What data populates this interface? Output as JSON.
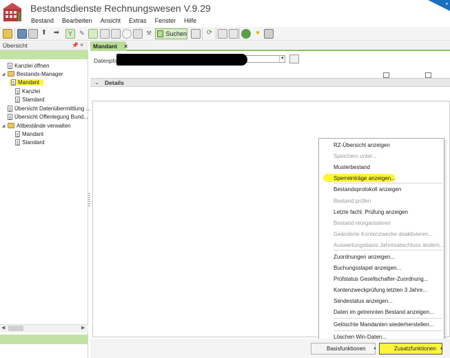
{
  "app": {
    "title": "Bestandsdienste Rechnungswesen V.9.29",
    "accent_green": "#8cc063",
    "highlight_yellow": "#fdf53a",
    "logo_icon": "house-grid-icon"
  },
  "menu": [
    "Bestand",
    "Bearbeiten",
    "Ansicht",
    "Extras",
    "Fenster",
    "Hilfe"
  ],
  "toolbar": {
    "search_label": "Suchen",
    "icons": [
      "open-folder-icon",
      "save-icon",
      "print-icon",
      "arrow-up-icon",
      "arrow-right-icon",
      "tree-icon",
      "wrench-icon",
      "grid-icon",
      "list-icon",
      "table-icon",
      "copy-icon",
      "clock-icon",
      "box-icon",
      "tools-icon",
      "export-icon",
      "refresh-icon",
      "panel-icon",
      "panel2-icon",
      "globe-icon",
      "lightbulb-icon",
      "tag-icon"
    ]
  },
  "sidebar": {
    "title": "Übersicht",
    "items": [
      {
        "label": "Kanzlei öffnen",
        "icon": "document-icon",
        "level": 0,
        "expander": ""
      },
      {
        "label": "Bestands-Manager",
        "icon": "folder-icon",
        "level": 0,
        "expander": "◢"
      },
      {
        "label": "Mandant",
        "icon": "document-icon",
        "level": 1,
        "expander": "",
        "selected": true
      },
      {
        "label": "Kanzlei",
        "icon": "document-icon",
        "level": 1,
        "expander": ""
      },
      {
        "label": "Standard",
        "icon": "document-icon",
        "level": 1,
        "expander": ""
      },
      {
        "label": "Übersicht Datenübermittlung ...",
        "icon": "document-icon",
        "level": 0,
        "expander": ""
      },
      {
        "label": "Übersicht Offenlegung Bund...",
        "icon": "document-icon",
        "level": 0,
        "expander": ""
      },
      {
        "label": "Altbestände verwalten",
        "icon": "folder-icon",
        "level": 0,
        "expander": "◢"
      },
      {
        "label": "Mandant",
        "icon": "document-icon",
        "level": 1,
        "expander": ""
      },
      {
        "label": "Standard",
        "icon": "document-icon",
        "level": 1,
        "expander": ""
      }
    ]
  },
  "tab": {
    "label": "Mandant",
    "close": "×"
  },
  "form": {
    "datenpfad_label": "Datenpfad"
  },
  "details": {
    "label": "Details"
  },
  "context_menu": {
    "items": [
      {
        "label": "RZ-Übersicht anzeigen",
        "enabled": true
      },
      {
        "label": "Speichern unter...",
        "enabled": false
      },
      {
        "label": "Musterbestand",
        "enabled": true
      },
      {
        "label": "Sperreinträge anzeigen...",
        "enabled": true,
        "highlighted": true
      },
      {
        "label": "Bestandsprotokoll anzeigen",
        "enabled": true
      },
      {
        "label": "Bestand prüfen",
        "enabled": false
      },
      {
        "label": "Letzte fachl. Prüfung anzeigen",
        "enabled": true
      },
      {
        "label": "Bestand reorganisieren",
        "enabled": false
      },
      {
        "label": "Geänderte Kontenzwecke deaktivieren...",
        "enabled": false
      },
      {
        "label": "Auswertungsbasis Jahresabschluss ändern...",
        "enabled": false
      },
      {
        "label": "Zuordnungen anzeigen...",
        "enabled": true
      },
      {
        "label": "Buchungsstapel anzeigen...",
        "enabled": true
      },
      {
        "label": "Prüfstatus Gesellschafter-Zuordnung...",
        "enabled": true
      },
      {
        "label": "Kontenzweckprüfung letzten 3 Jahre...",
        "enabled": true
      },
      {
        "label": "Sendestatus anzeigen...",
        "enabled": true
      },
      {
        "label": "Daten im getrennten Bestand anzeigen...",
        "enabled": true
      },
      {
        "label": "Gelöschte Mandanten wiederherstellen...",
        "enabled": true
      },
      {
        "label": "Löschen Win-Daten...",
        "enabled": true
      }
    ]
  },
  "buttons": {
    "basis_label": "Basisfunktionen",
    "zusatz_label": "Zusatzfunktionen"
  }
}
